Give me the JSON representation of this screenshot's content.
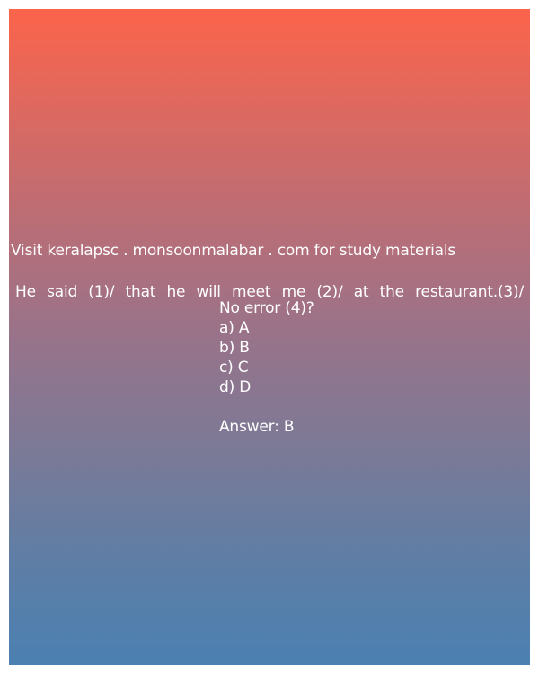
{
  "promo_text": "Visit keralapsc . monsoonmalabar . com for study materials",
  "question": {
    "line1": "He said (1)/ that he will meet me (2)/ at the restaurant.(3)/",
    "line2": "No error (4)?"
  },
  "options": [
    "a) A",
    "b) B",
    "c) C",
    "d) D"
  ],
  "answer": "Answer: B"
}
